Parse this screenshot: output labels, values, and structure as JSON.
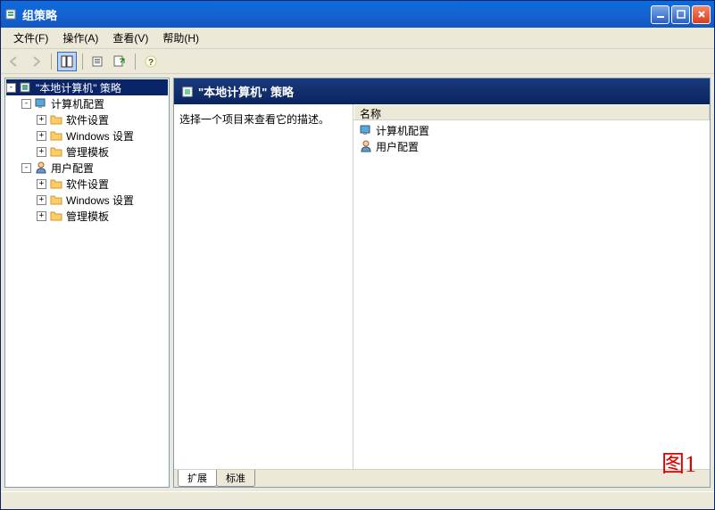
{
  "window": {
    "title": "组策略"
  },
  "menu": {
    "file": "文件(F)",
    "action": "操作(A)",
    "view": "查看(V)",
    "help": "帮助(H)"
  },
  "tree": {
    "root": "\"本地计算机\" 策略",
    "computer_config": "计算机配置",
    "software_settings": "软件设置",
    "windows_settings": "Windows 设置",
    "admin_templates": "管理模板",
    "user_config": "用户配置"
  },
  "main": {
    "header_title": "\"本地计算机\" 策略",
    "description": "选择一个项目来查看它的描述。",
    "column_name": "名称",
    "item_computer": "计算机配置",
    "item_user": "用户配置"
  },
  "tabs": {
    "extended": "扩展",
    "standard": "标准"
  },
  "watermark": "图1"
}
